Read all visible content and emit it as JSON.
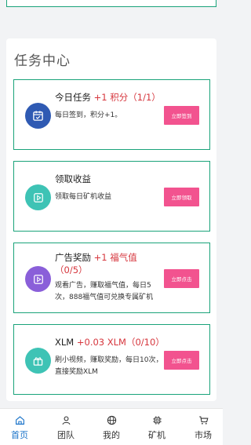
{
  "task_center": {
    "title": "任务中心",
    "tasks": [
      {
        "title": "今日任务",
        "highlight": "+1 积分（1/1）",
        "desc": "每日签到，积分+1。",
        "button": "立即签到",
        "icon": "calendar-check-icon",
        "icon_color": "#2f5ab3"
      },
      {
        "title": "领取收益",
        "highlight": "",
        "desc": "领取每日矿机收益",
        "button": "立即领取",
        "icon": "play-square-icon",
        "icon_color": "#3ec3b5"
      },
      {
        "title": "广告奖励",
        "highlight": "+1 福气值（0/5）",
        "desc": "观看广告，赚取福气值，每日5次，888福气值可兑换专属矿机",
        "button": "立即点击",
        "icon": "play-square-icon",
        "icon_color": "#8a5fd9"
      },
      {
        "title": "XLM",
        "highlight": "+0.03 XLM（0/10）",
        "desc": "刷小视频，赚取奖励，每日10次，直接奖励XLM",
        "button": "立即点击",
        "icon": "gift-box-icon",
        "icon_color": "#3ec3b5"
      }
    ]
  },
  "tabbar": {
    "items": [
      {
        "label": "首页",
        "icon": "home-icon",
        "active": true
      },
      {
        "label": "团队",
        "icon": "team-icon",
        "active": false
      },
      {
        "label": "我的",
        "icon": "globe-icon",
        "active": false
      },
      {
        "label": "矿机",
        "icon": "chip-icon",
        "active": false
      },
      {
        "label": "市场",
        "icon": "cart-icon",
        "active": false
      }
    ],
    "active_color": "#1a73c9"
  }
}
